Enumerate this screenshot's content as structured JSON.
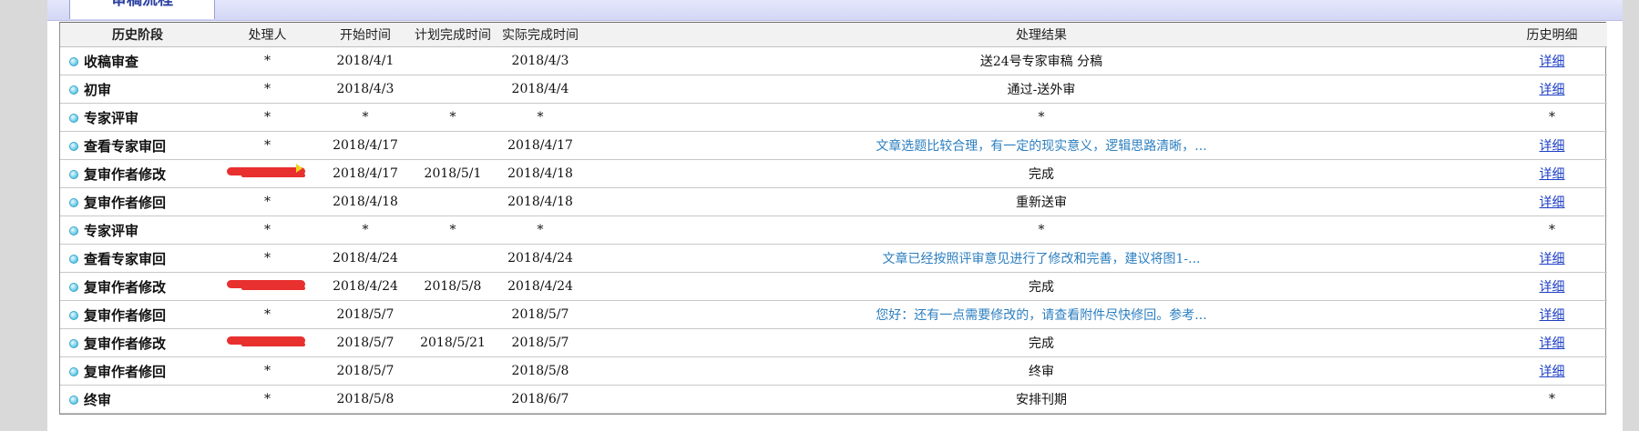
{
  "tab": {
    "label": "审稿流程"
  },
  "columns": [
    "历史阶段",
    "处理人",
    "开始时间",
    "计划完成时间",
    "实际完成时间",
    "处理结果",
    "历史明细"
  ],
  "rows": [
    {
      "stage": "收稿审查",
      "handler": "*",
      "start": "2018/4/1",
      "planned": "",
      "actual": "2018/4/3",
      "result": "送24号专家审稿 分稿",
      "result_link": false,
      "detail": "详细",
      "detail_link": true,
      "handler_redacted": false
    },
    {
      "stage": "初审",
      "handler": "*",
      "start": "2018/4/3",
      "planned": "",
      "actual": "2018/4/4",
      "result": "通过-送外审",
      "result_link": false,
      "detail": "详细",
      "detail_link": true,
      "handler_redacted": false
    },
    {
      "stage": "专家评审",
      "handler": "*",
      "start": "*",
      "planned": "*",
      "actual": "*",
      "result": "*",
      "result_link": false,
      "detail": "*",
      "detail_link": false,
      "handler_redacted": false
    },
    {
      "stage": "查看专家审回",
      "handler": "*",
      "start": "2018/4/17",
      "planned": "",
      "actual": "2018/4/17",
      "result": "文章选题比较合理，有一定的现实意义，逻辑思路清晰，...",
      "result_link": true,
      "detail": "详细",
      "detail_link": true,
      "handler_redacted": false
    },
    {
      "stage": "复审作者修改",
      "handler": "",
      "start": "2018/4/17",
      "planned": "2018/5/1",
      "actual": "2018/4/18",
      "result": "完成",
      "result_link": false,
      "detail": "详细",
      "detail_link": true,
      "handler_redacted": true
    },
    {
      "stage": "复审作者修回",
      "handler": "*",
      "start": "2018/4/18",
      "planned": "",
      "actual": "2018/4/18",
      "result": "重新送审",
      "result_link": false,
      "detail": "详细",
      "detail_link": true,
      "handler_redacted": false
    },
    {
      "stage": "专家评审",
      "handler": "*",
      "start": "*",
      "planned": "*",
      "actual": "*",
      "result": "*",
      "result_link": false,
      "detail": "*",
      "detail_link": false,
      "handler_redacted": false
    },
    {
      "stage": "查看专家审回",
      "handler": "*",
      "start": "2018/4/24",
      "planned": "",
      "actual": "2018/4/24",
      "result": "文章已经按照评审意见进行了修改和完善，建议将图1-...",
      "result_link": true,
      "detail": "详细",
      "detail_link": true,
      "handler_redacted": false
    },
    {
      "stage": "复审作者修改",
      "handler": "",
      "start": "2018/4/24",
      "planned": "2018/5/8",
      "actual": "2018/4/24",
      "result": "完成",
      "result_link": false,
      "detail": "详细",
      "detail_link": true,
      "handler_redacted": true
    },
    {
      "stage": "复审作者修回",
      "handler": "*",
      "start": "2018/5/7",
      "planned": "",
      "actual": "2018/5/7",
      "result": "您好：还有一点需要修改的，请查看附件尽快修回。参考...",
      "result_link": true,
      "detail": "详细",
      "detail_link": true,
      "handler_redacted": false
    },
    {
      "stage": "复审作者修改",
      "handler": "",
      "start": "2018/5/7",
      "planned": "2018/5/21",
      "actual": "2018/5/7",
      "result": "完成",
      "result_link": false,
      "detail": "详细",
      "detail_link": true,
      "handler_redacted": true
    },
    {
      "stage": "复审作者修回",
      "handler": "*",
      "start": "2018/5/7",
      "planned": "",
      "actual": "2018/5/8",
      "result": "终审",
      "result_link": false,
      "detail": "详细",
      "detail_link": true,
      "handler_redacted": false
    },
    {
      "stage": "终审",
      "handler": "*",
      "start": "2018/5/8",
      "planned": "",
      "actual": "2018/6/7",
      "result": "安排刊期",
      "result_link": false,
      "detail": "*",
      "detail_link": false,
      "handler_redacted": false
    }
  ]
}
